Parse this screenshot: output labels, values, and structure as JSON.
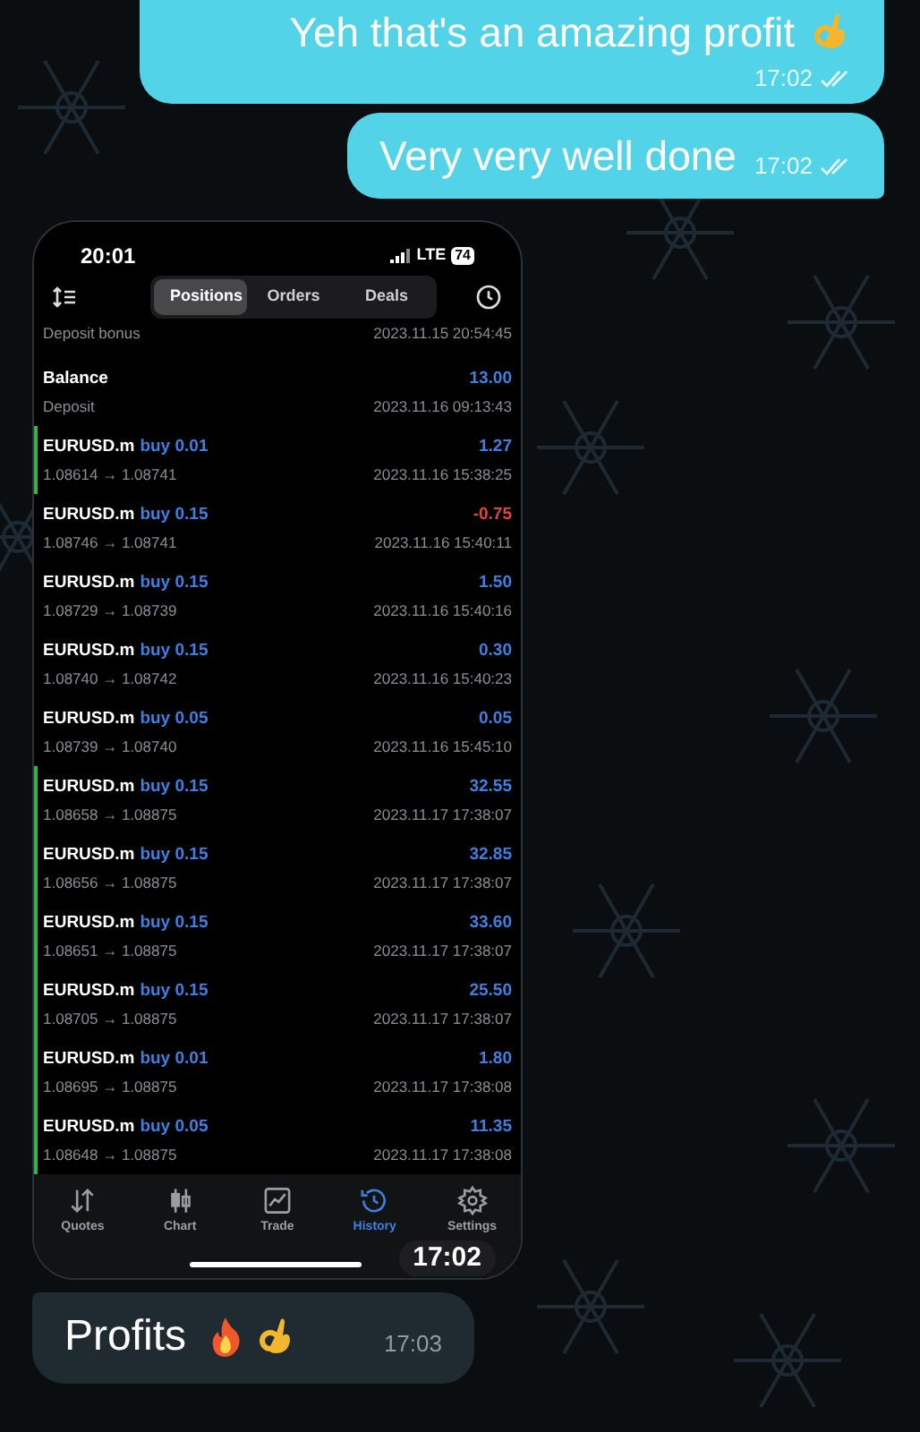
{
  "messages_top": [
    {
      "text": "Yeh that's an amazing profit",
      "time": "17:02"
    },
    {
      "text": "Very very well done",
      "time": "17:02"
    }
  ],
  "phone": {
    "status": {
      "time": "20:01",
      "network": "LTE",
      "battery": "74"
    },
    "tabs": [
      {
        "label": "Positions",
        "selected": true
      },
      {
        "label": "Orders",
        "selected": false
      },
      {
        "label": "Deals",
        "selected": false
      }
    ],
    "rows": [
      {
        "kind": "partial",
        "label": "Deposit bonus",
        "date": "2023.11.15 20:54:45"
      },
      {
        "kind": "balance",
        "title": "Balance",
        "label": "Deposit",
        "amount": "13.00",
        "date": "2023.11.16 09:13:43"
      },
      {
        "kind": "trade",
        "symbol": "EURUSD.m",
        "side": "buy 0.01",
        "profit": "1.27",
        "loss": false,
        "marked": true,
        "prices": "1.08614 → 1.08741",
        "date": "2023.11.16 15:38:25"
      },
      {
        "kind": "trade",
        "symbol": "EURUSD.m",
        "side": "buy 0.15",
        "profit": "-0.75",
        "loss": true,
        "marked": false,
        "prices": "1.08746 → 1.08741",
        "date": "2023.11.16 15:40:11"
      },
      {
        "kind": "trade",
        "symbol": "EURUSD.m",
        "side": "buy 0.15",
        "profit": "1.50",
        "loss": false,
        "marked": false,
        "prices": "1.08729 → 1.08739",
        "date": "2023.11.16 15:40:16"
      },
      {
        "kind": "trade",
        "symbol": "EURUSD.m",
        "side": "buy 0.15",
        "profit": "0.30",
        "loss": false,
        "marked": false,
        "prices": "1.08740 → 1.08742",
        "date": "2023.11.16 15:40:23"
      },
      {
        "kind": "trade",
        "symbol": "EURUSD.m",
        "side": "buy 0.05",
        "profit": "0.05",
        "loss": false,
        "marked": false,
        "prices": "1.08739 → 1.08740",
        "date": "2023.11.16 15:45:10"
      },
      {
        "kind": "trade",
        "symbol": "EURUSD.m",
        "side": "buy 0.15",
        "profit": "32.55",
        "loss": false,
        "marked": true,
        "prices": "1.08658 → 1.08875",
        "date": "2023.11.17 17:38:07"
      },
      {
        "kind": "trade",
        "symbol": "EURUSD.m",
        "side": "buy 0.15",
        "profit": "32.85",
        "loss": false,
        "marked": true,
        "prices": "1.08656 → 1.08875",
        "date": "2023.11.17 17:38:07"
      },
      {
        "kind": "trade",
        "symbol": "EURUSD.m",
        "side": "buy 0.15",
        "profit": "33.60",
        "loss": false,
        "marked": true,
        "prices": "1.08651 → 1.08875",
        "date": "2023.11.17 17:38:07"
      },
      {
        "kind": "trade",
        "symbol": "EURUSD.m",
        "side": "buy 0.15",
        "profit": "25.50",
        "loss": false,
        "marked": true,
        "prices": "1.08705 → 1.08875",
        "date": "2023.11.17 17:38:07"
      },
      {
        "kind": "trade",
        "symbol": "EURUSD.m",
        "side": "buy 0.01",
        "profit": "1.80",
        "loss": false,
        "marked": true,
        "prices": "1.08695 → 1.08875",
        "date": "2023.11.17 17:38:08"
      },
      {
        "kind": "trade",
        "symbol": "EURUSD.m",
        "side": "buy 0.05",
        "profit": "11.35",
        "loss": false,
        "marked": true,
        "prices": "1.08648 → 1.08875",
        "date": "2023.11.17 17:38:08"
      }
    ],
    "nav": [
      {
        "label": "Quotes",
        "selected": false
      },
      {
        "label": "Chart",
        "selected": false
      },
      {
        "label": "Trade",
        "selected": false
      },
      {
        "label": "History",
        "selected": true
      },
      {
        "label": "Settings",
        "selected": false
      }
    ],
    "time_badge": "17:02"
  },
  "message_bottom": {
    "text": "Profits",
    "time": "17:03"
  }
}
